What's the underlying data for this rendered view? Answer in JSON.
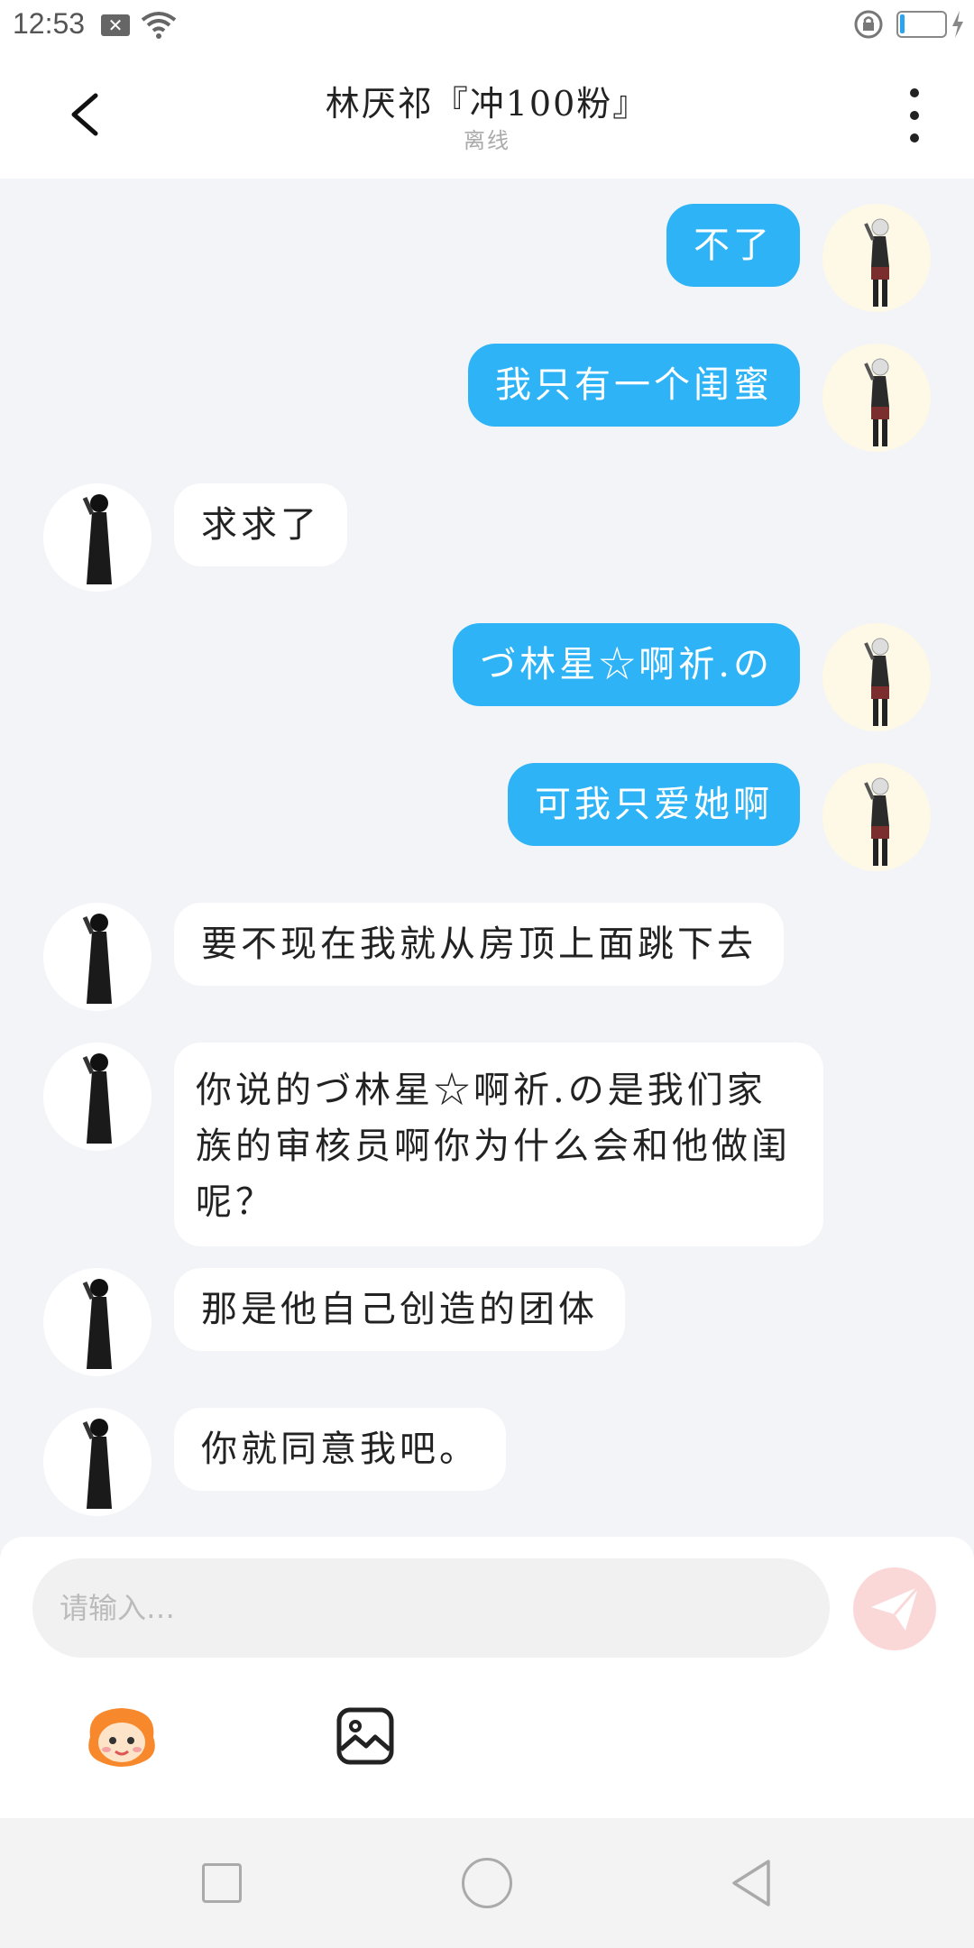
{
  "status_bar": {
    "time": "12:53"
  },
  "header": {
    "title": "林厌祁『冲100粉』",
    "subtitle": "离线",
    "back_icon": "chevron-left-icon",
    "more_icon": "more-vertical-icon"
  },
  "messages": [
    {
      "from": "me",
      "text": "不了"
    },
    {
      "from": "me",
      "text": "我只有一个闺蜜"
    },
    {
      "from": "other",
      "text": "求求了"
    },
    {
      "from": "me",
      "text": "づ林星☆啊祈.の"
    },
    {
      "from": "me",
      "text": "可我只爱她啊"
    },
    {
      "from": "other",
      "text": "要不现在我就从房顶上面跳下去"
    },
    {
      "from": "other",
      "text": "你说的づ林星☆啊祈.の是我们家族的审核员啊你为什么会和他做闺呢？"
    },
    {
      "from": "other",
      "text": "那是他自己创造的团体"
    },
    {
      "from": "other",
      "text": "你就同意我吧。"
    }
  ],
  "input": {
    "placeholder": "请输入…",
    "value": ""
  },
  "toolbar": {
    "emoji_icon": "emoji-sticker-icon",
    "image_icon": "image-icon",
    "send_icon": "send-icon"
  },
  "colors": {
    "my_bubble": "#2eb4f6",
    "other_bubble": "#ffffff",
    "background": "#f3f4f8"
  }
}
